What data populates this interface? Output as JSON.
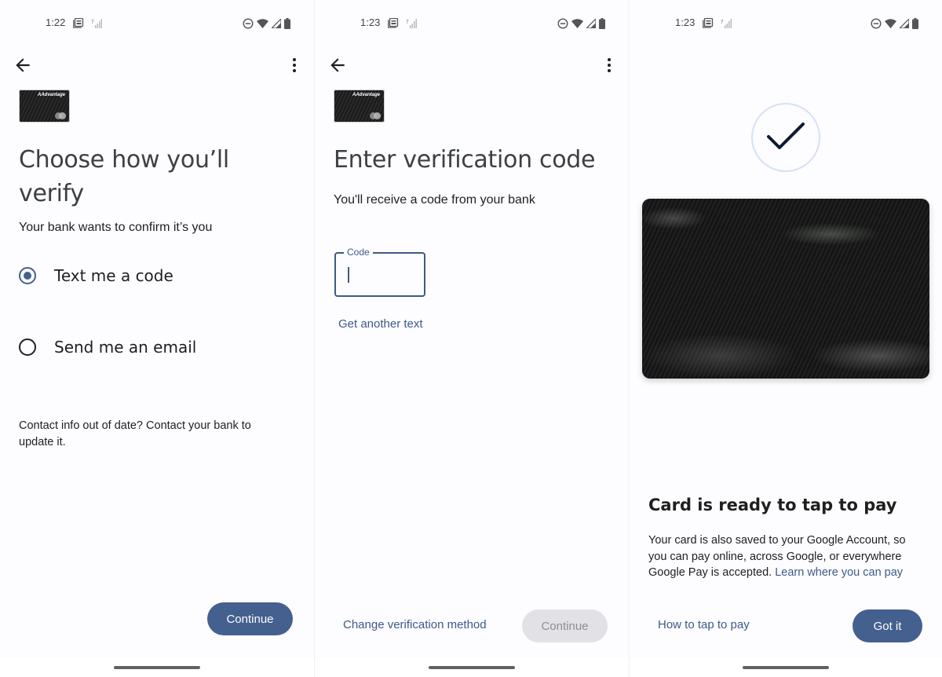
{
  "colors": {
    "primary": "#44608f",
    "link": "#3d5a8a",
    "surface": "#fdfcff",
    "disabled_bg": "#e2e2e6",
    "check_ring": "#d5e1f6"
  },
  "screens": [
    {
      "status": {
        "time": "1:22"
      },
      "card_brand": "AAdvantage",
      "title": "Choose how you’ll verify",
      "subtitle": "Your bank wants to confirm it’s you",
      "options": [
        {
          "label": "Text me a code",
          "selected": true
        },
        {
          "label": "Send me an email",
          "selected": false
        }
      ],
      "note": "Contact info out of date? Contact your bank to update it.",
      "primary_button": "Continue"
    },
    {
      "status": {
        "time": "1:23"
      },
      "card_brand": "AAdvantage",
      "title": "Enter verification code",
      "subtitle": "You'll receive a code from your bank",
      "code_field": {
        "label": "Code",
        "value": ""
      },
      "resend_link": "Get another text",
      "secondary_button": "Change verification method",
      "primary_button": "Continue",
      "primary_enabled": false
    },
    {
      "status": {
        "time": "1:23"
      },
      "title": "Card is ready to tap to pay",
      "description": "Your card is also saved to your Google Account, so you can pay online, across Google, or everywhere Google Pay is accepted.",
      "description_link": "Learn where you can pay",
      "secondary_button": "How to tap to pay",
      "primary_button": "Got it"
    }
  ],
  "icons": {
    "status_left": [
      "news-notification-icon",
      "no-signal-icon"
    ],
    "status_right": [
      "do-not-disturb-icon",
      "wifi-icon",
      "cell-signal-icon",
      "battery-icon"
    ],
    "appbar": [
      "back-arrow-icon",
      "more-vert-icon"
    ],
    "success": "checkmark-icon"
  }
}
